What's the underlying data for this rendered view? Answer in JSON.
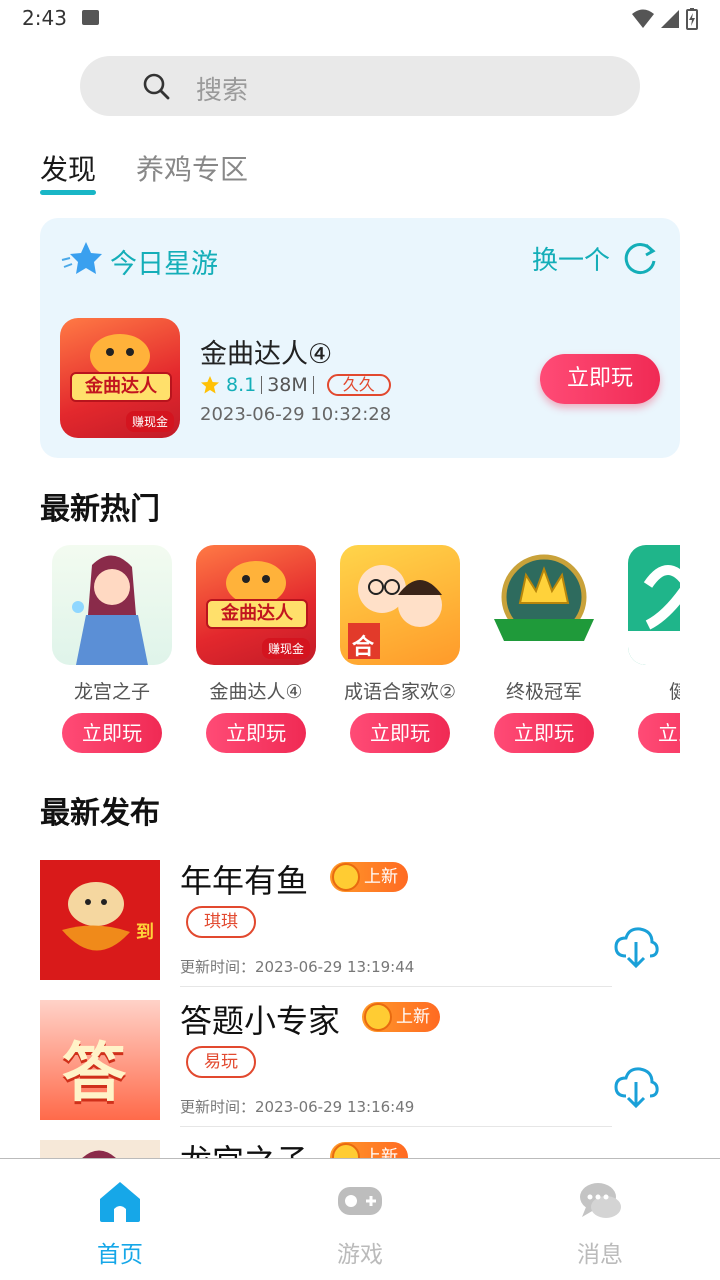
{
  "status_bar": {
    "time": "2:43"
  },
  "search": {
    "placeholder": "搜索"
  },
  "tabs": [
    {
      "label": "发现"
    },
    {
      "label": "养鸡专区"
    }
  ],
  "star_card": {
    "title": "今日星游",
    "swap_label": "换一个",
    "game": {
      "name": "金曲达人④",
      "thumb_text": "金曲达人",
      "thumb_badge": "赚现金",
      "rating": "8.1",
      "size": "38M",
      "tag": "久久",
      "date": "2023-06-29 10:32:28",
      "play_label": "立即玩"
    }
  },
  "hot": {
    "title": "最新热门",
    "items": [
      {
        "name": "龙宫之子",
        "play_label": "立即玩"
      },
      {
        "name": "金曲达人④",
        "play_label": "立即玩",
        "thumb_text": "金曲达人",
        "thumb_badge": "赚现金"
      },
      {
        "name": "成语合家欢②",
        "play_label": "立即玩",
        "thumb_text": "合"
      },
      {
        "name": "终极冠军",
        "play_label": "立即玩"
      },
      {
        "name": "健步",
        "play_label": "立即玩"
      }
    ]
  },
  "latest": {
    "title": "最新发布",
    "new_badge": "上新",
    "items": [
      {
        "name": "年年有鱼",
        "tag": "琪琪",
        "time": "更新时间：2023-06-29 13:19:44",
        "thumb_text": "到"
      },
      {
        "name": "答题小专家",
        "tag": "易玩",
        "time": "更新时间：2023-06-29 13:16:49",
        "thumb_text": "答"
      },
      {
        "name": "龙宫之子",
        "tag": "",
        "time": ""
      }
    ]
  },
  "bottom_nav": [
    {
      "label": "首页",
      "active": true
    },
    {
      "label": "游戏",
      "active": false
    },
    {
      "label": "消息",
      "active": false
    }
  ],
  "colors": {
    "accent": "#19b6c6",
    "play": "#f02a54",
    "tag": "#e2492f",
    "new_badge": "#ff7a24"
  }
}
